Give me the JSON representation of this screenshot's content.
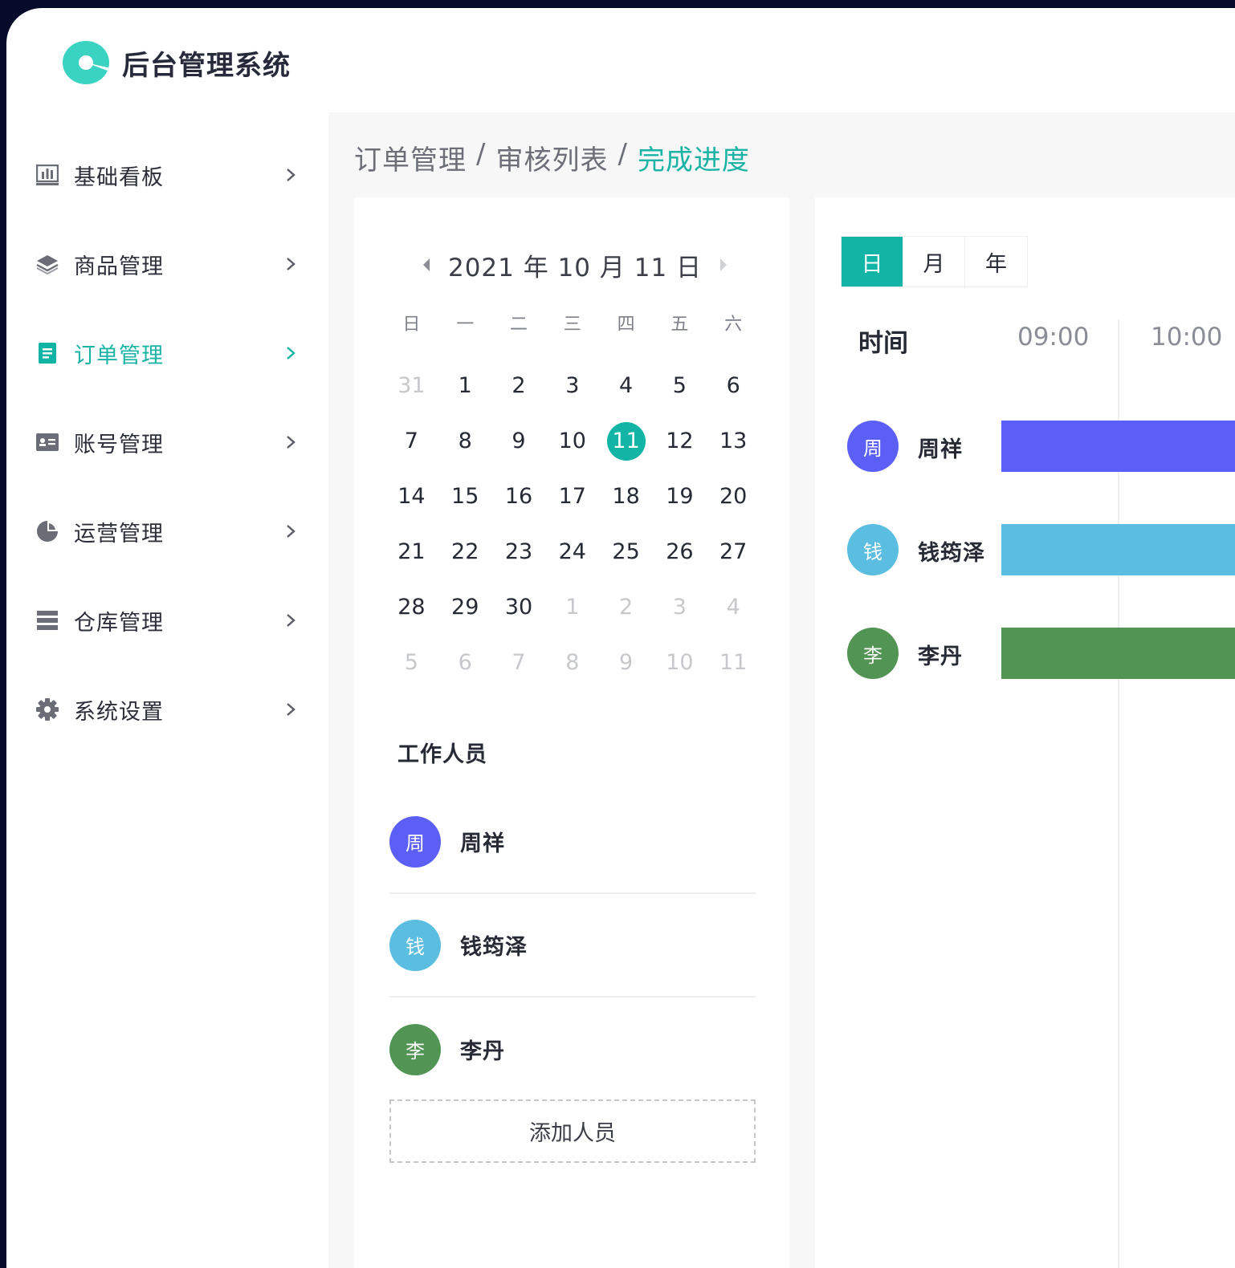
{
  "app": {
    "title": "后台管理系统"
  },
  "sidebar": {
    "items": [
      {
        "label": "基础看板",
        "icon": "bar-chart-icon",
        "active": false
      },
      {
        "label": "商品管理",
        "icon": "layers-icon",
        "active": false
      },
      {
        "label": "订单管理",
        "icon": "document-icon",
        "active": true
      },
      {
        "label": "账号管理",
        "icon": "id-card-icon",
        "active": false
      },
      {
        "label": "运营管理",
        "icon": "pie-chart-icon",
        "active": false
      },
      {
        "label": "仓库管理",
        "icon": "list-icon",
        "active": false
      },
      {
        "label": "系统设置",
        "icon": "gear-icon",
        "active": false
      }
    ]
  },
  "breadcrumb": {
    "items": [
      "订单管理",
      "审核列表",
      "完成进度"
    ],
    "separator": "/"
  },
  "calendar": {
    "title": "2021 年 10 月 11 日",
    "weekdays": [
      "日",
      "一",
      "二",
      "三",
      "四",
      "五",
      "六"
    ],
    "days": [
      {
        "n": "31",
        "muted": true
      },
      {
        "n": "1"
      },
      {
        "n": "2"
      },
      {
        "n": "3"
      },
      {
        "n": "4"
      },
      {
        "n": "5"
      },
      {
        "n": "6"
      },
      {
        "n": "7"
      },
      {
        "n": "8"
      },
      {
        "n": "9"
      },
      {
        "n": "10"
      },
      {
        "n": "11",
        "selected": true
      },
      {
        "n": "12"
      },
      {
        "n": "13"
      },
      {
        "n": "14"
      },
      {
        "n": "15"
      },
      {
        "n": "16"
      },
      {
        "n": "17"
      },
      {
        "n": "18"
      },
      {
        "n": "19"
      },
      {
        "n": "20"
      },
      {
        "n": "21"
      },
      {
        "n": "22"
      },
      {
        "n": "23"
      },
      {
        "n": "24"
      },
      {
        "n": "25"
      },
      {
        "n": "26"
      },
      {
        "n": "27"
      },
      {
        "n": "28"
      },
      {
        "n": "29"
      },
      {
        "n": "30"
      },
      {
        "n": "1",
        "muted": true
      },
      {
        "n": "2",
        "muted": true
      },
      {
        "n": "3",
        "muted": true
      },
      {
        "n": "4",
        "muted": true
      },
      {
        "n": "5",
        "muted": true
      },
      {
        "n": "6",
        "muted": true
      },
      {
        "n": "7",
        "muted": true
      },
      {
        "n": "8",
        "muted": true
      },
      {
        "n": "9",
        "muted": true
      },
      {
        "n": "10",
        "muted": true
      },
      {
        "n": "11",
        "muted": true
      }
    ]
  },
  "workers": {
    "title": "工作人员",
    "list": [
      {
        "initial": "周",
        "name": "周祥",
        "color": "#5b5ff5"
      },
      {
        "initial": "钱",
        "name": "钱筠泽",
        "color": "#5bbde0"
      },
      {
        "initial": "李",
        "name": "李丹",
        "color": "#529453"
      }
    ],
    "add_label": "添加人员"
  },
  "schedule": {
    "tabs": [
      {
        "label": "日",
        "active": true
      },
      {
        "label": "月",
        "active": false
      },
      {
        "label": "年",
        "active": false
      }
    ],
    "time_label": "时间",
    "hours": [
      "09:00",
      "10:00"
    ]
  },
  "colors": {
    "accent": "#12b5a5",
    "logo": "#3ad2c1",
    "frame": "#050a2a"
  }
}
